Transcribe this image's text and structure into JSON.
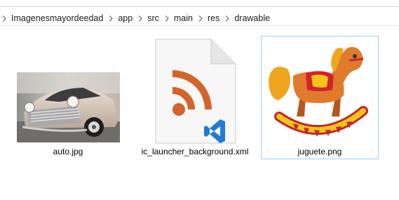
{
  "breadcrumb": {
    "items": [
      {
        "label": "Imagenesmayordeedad"
      },
      {
        "label": "app"
      },
      {
        "label": "src"
      },
      {
        "label": "main"
      },
      {
        "label": "res"
      },
      {
        "label": "drawable"
      }
    ]
  },
  "files": [
    {
      "name": "auto.jpg",
      "icon": "car-photo-thumbnail",
      "selected": false
    },
    {
      "name": "ic_launcher_background.xml",
      "icon": "xml-file-icon",
      "selected": false
    },
    {
      "name": "juguete.png",
      "icon": "rocking-horse-thumbnail",
      "selected": true
    }
  ],
  "colors": {
    "selection_border": "#99d1ff",
    "rss_orange": "#d2652a",
    "vscode_blue": "#1f7bd3"
  }
}
